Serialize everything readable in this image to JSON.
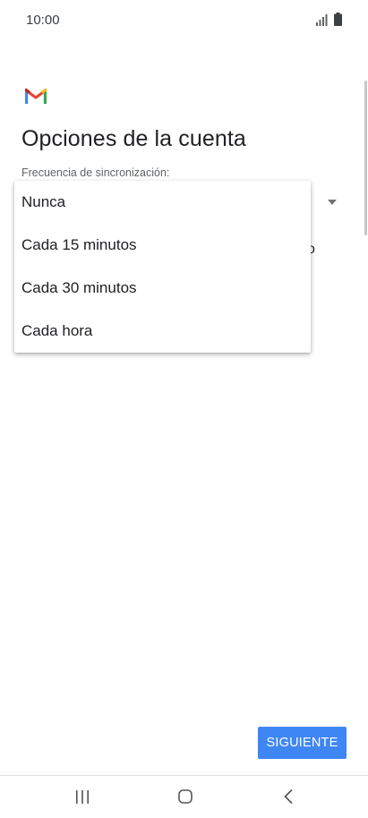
{
  "status_bar": {
    "time": "10:00"
  },
  "page": {
    "title": "Opciones de la cuenta",
    "field_label": "Frecuencia de sincronización:",
    "partial_text": "o"
  },
  "menu": {
    "items": [
      {
        "label": "Nunca"
      },
      {
        "label": "Cada 15 minutos"
      },
      {
        "label": "Cada 30 minutos"
      },
      {
        "label": "Cada hora"
      }
    ]
  },
  "buttons": {
    "next_label": "SIGUIENTE"
  },
  "colors": {
    "accent": "#3f86f5",
    "gmail_red": "#ea4335",
    "gmail_blue": "#4285f4",
    "gmail_green": "#34a853",
    "gmail_yellow": "#fbbc04"
  }
}
